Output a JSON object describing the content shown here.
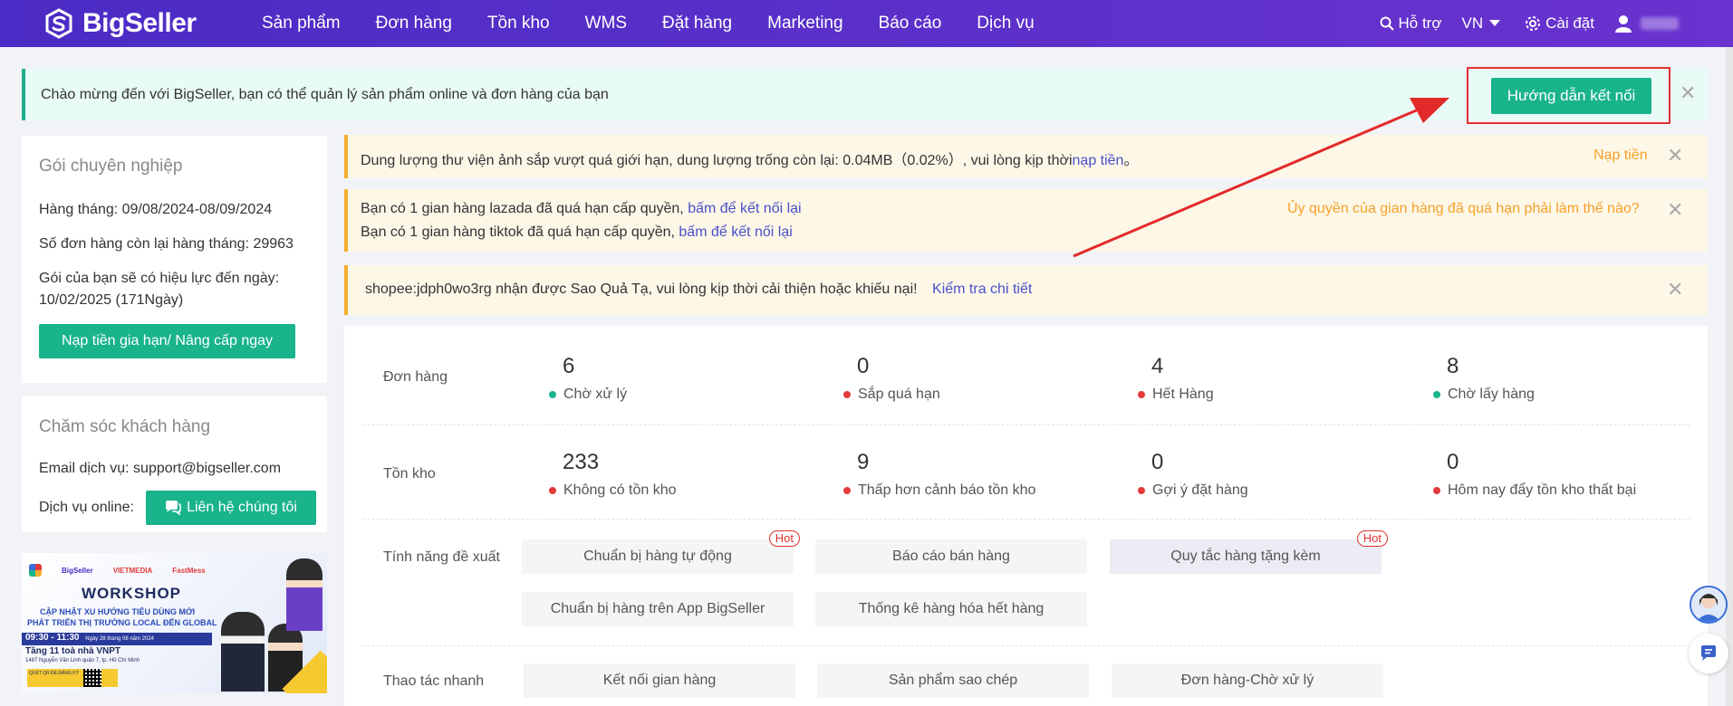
{
  "brand": {
    "name": "BigSeller",
    "accent": "#19b38c",
    "nav_bg": "#5a30c9"
  },
  "nav": {
    "items": [
      "Sản phẩm",
      "Đơn hàng",
      "Tồn kho",
      "WMS",
      "Đặt hàng",
      "Marketing",
      "Báo cáo",
      "Dịch vụ"
    ],
    "support": "Hỗ trợ",
    "lang": "VN",
    "settings": "Cài đặt"
  },
  "welcome": {
    "text": "Chào mừng đến với BigSeller, bạn có thể quản lý sản phẩm online và đơn hàng của bạn",
    "button": "Hướng dẫn kết nối"
  },
  "plan": {
    "title": "Gói chuyên nghiệp",
    "monthly": "Hàng tháng: 09/08/2024-08/09/2024",
    "remaining": "Số đơn hàng còn lại hàng tháng: 29963",
    "valid_line1": "Gói của bạn sẽ có hiệu lực đến ngày:",
    "valid_line2": "10/02/2025 (171Ngày)",
    "button": "Nạp tiền gia hạn/ Nâng cấp ngay"
  },
  "care": {
    "title": "Chăm sóc khách hàng",
    "email": "Email dịch vụ:  support@bigseller.com",
    "online_label": "Dịch vụ online:",
    "button": "Liên hệ chúng tôi"
  },
  "promo": {
    "logos": [
      "BigSeller",
      "VIETMEDIA",
      "FastMess"
    ],
    "title": "WORKSHOP",
    "line1": "CẬP NHẬT XU HƯỚNG TIÊU DÙNG MỚI",
    "line2": "PHÁT TRIỂN THỊ TRƯỜNG LOCAL ĐẾN GLOBAL",
    "time": "09:30 - 11:30",
    "date": "Ngày 28 tháng 08 năm 2024",
    "venue": "Tầng 11 toà nhà VNPT",
    "address": "1487 Nguyễn Văn Linh quận 7, tp. Hồ Chí Minh",
    "register": "QUÉT QR ĐỂ ĐĂNG KÝ"
  },
  "alerts": {
    "storage_text": "Dung lượng thư viện ảnh sắp vượt quá giới hạn, dung lượng trống còn lại: 0.04MB（0.02%）, vui lòng kịp thời",
    "storage_link": "nạp tiền",
    "storage_end": "。",
    "storage_action": "Nạp tiền",
    "auth_line1": "Bạn có 1 gian hàng lazada đã quá hạn cấp quyền,",
    "auth_line2": "Bạn có 1 gian hàng tiktok đã quá hạn cấp quyền,",
    "auth_link": "bấm để kết nối lại",
    "auth_help": "Ủy quyền của gian hàng đã quá hạn phải làm thế nào?",
    "shopee_text": "shopee:jdph0wo3rg nhận được Sao Quả Tạ, vui lòng kịp thời cải thiện hoặc khiếu nại!",
    "shopee_link": "Kiểm tra chi tiết"
  },
  "orders": {
    "label": "Đơn hàng",
    "stats": [
      {
        "num": "6",
        "label": "Chờ xử lý",
        "color": "#19b38c"
      },
      {
        "num": "0",
        "label": "Sắp quá hạn",
        "color": "#e23b3b"
      },
      {
        "num": "4",
        "label": "Hết Hàng",
        "color": "#e23b3b"
      },
      {
        "num": "8",
        "label": "Chờ lấy hàng",
        "color": "#19b38c"
      }
    ]
  },
  "inventory": {
    "label": "Tồn kho",
    "stats": [
      {
        "num": "233",
        "label": "Không có tồn kho",
        "color": "#e23b3b"
      },
      {
        "num": "9",
        "label": "Thấp hơn cảnh báo tồn kho",
        "color": "#e23b3b"
      },
      {
        "num": "0",
        "label": "Gợi ý đặt hàng",
        "color": "#e23b3b"
      },
      {
        "num": "0",
        "label": "Hôm nay đẩy tồn kho thất bại",
        "color": "#e23b3b"
      }
    ]
  },
  "features": {
    "label": "Tính năng đề xuất",
    "hot": "Hot",
    "items": [
      "Chuẩn bị hàng tự động",
      "Báo cáo bán hàng",
      "Quy tắc hàng tặng kèm",
      "Chuẩn bị hàng trên App BigSeller",
      "Thống kê hàng hóa hết hàng"
    ]
  },
  "quick": {
    "label": "Thao tác nhanh",
    "items": [
      "Kết nối gian hàng",
      "Sản phẩm sao chép",
      "Đơn hàng-Chờ xử lý"
    ]
  }
}
